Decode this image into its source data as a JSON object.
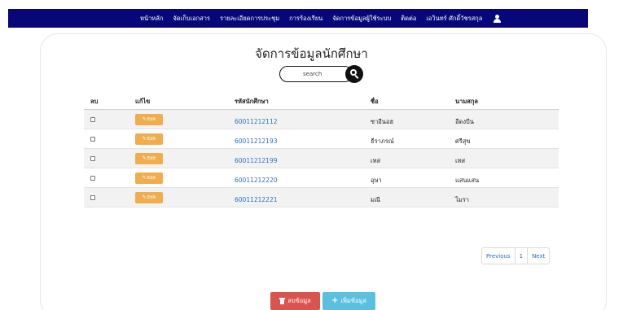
{
  "nav": {
    "items": [
      "หน้าหลัก",
      "จัดเก็บเอกสาร",
      "รายละเอียดการประชุม",
      "การร้องเรียน",
      "จัดการข้อมูลผู้ใช้ระบบ",
      "ติดต่อ",
      "เอวินทร์ ศักดิ์วัชรสกุล"
    ],
    "user_icon": "user-icon",
    "bg_color": "#07077a"
  },
  "page": {
    "title": "จัดการข้อมูลนักศึกษา"
  },
  "search": {
    "placeholder": "search",
    "icon": "search-icon"
  },
  "table": {
    "columns": [
      "ลบ",
      "แก้ไข",
      "รหัสนักศึกษา",
      "ชื่อ",
      "นามสกุล"
    ],
    "edit_label": "Edit",
    "rows": [
      {
        "id": "60011212112",
        "first_name": "ซาอีนอฮ",
        "last_name": "อีดงบีน"
      },
      {
        "id": "60011212193",
        "first_name": "ธีราภรณ์",
        "last_name": "ศรีสุข"
      },
      {
        "id": "60011212199",
        "first_name": "เทส",
        "last_name": "เทส"
      },
      {
        "id": "60011212220",
        "first_name": "อุษา",
        "last_name": "แสนแสน"
      },
      {
        "id": "60011212221",
        "first_name": "มณี",
        "last_name": "ไมรา"
      }
    ]
  },
  "pagination": {
    "previous": "Previous",
    "current": "1",
    "next": "Next"
  },
  "actions": {
    "delete_label": "ลบข้อมูล",
    "add_label": "เพิ่มข้อมูล",
    "delete_color": "#d9534f",
    "add_color": "#5bc0de",
    "edit_color": "#f0ad4e"
  }
}
